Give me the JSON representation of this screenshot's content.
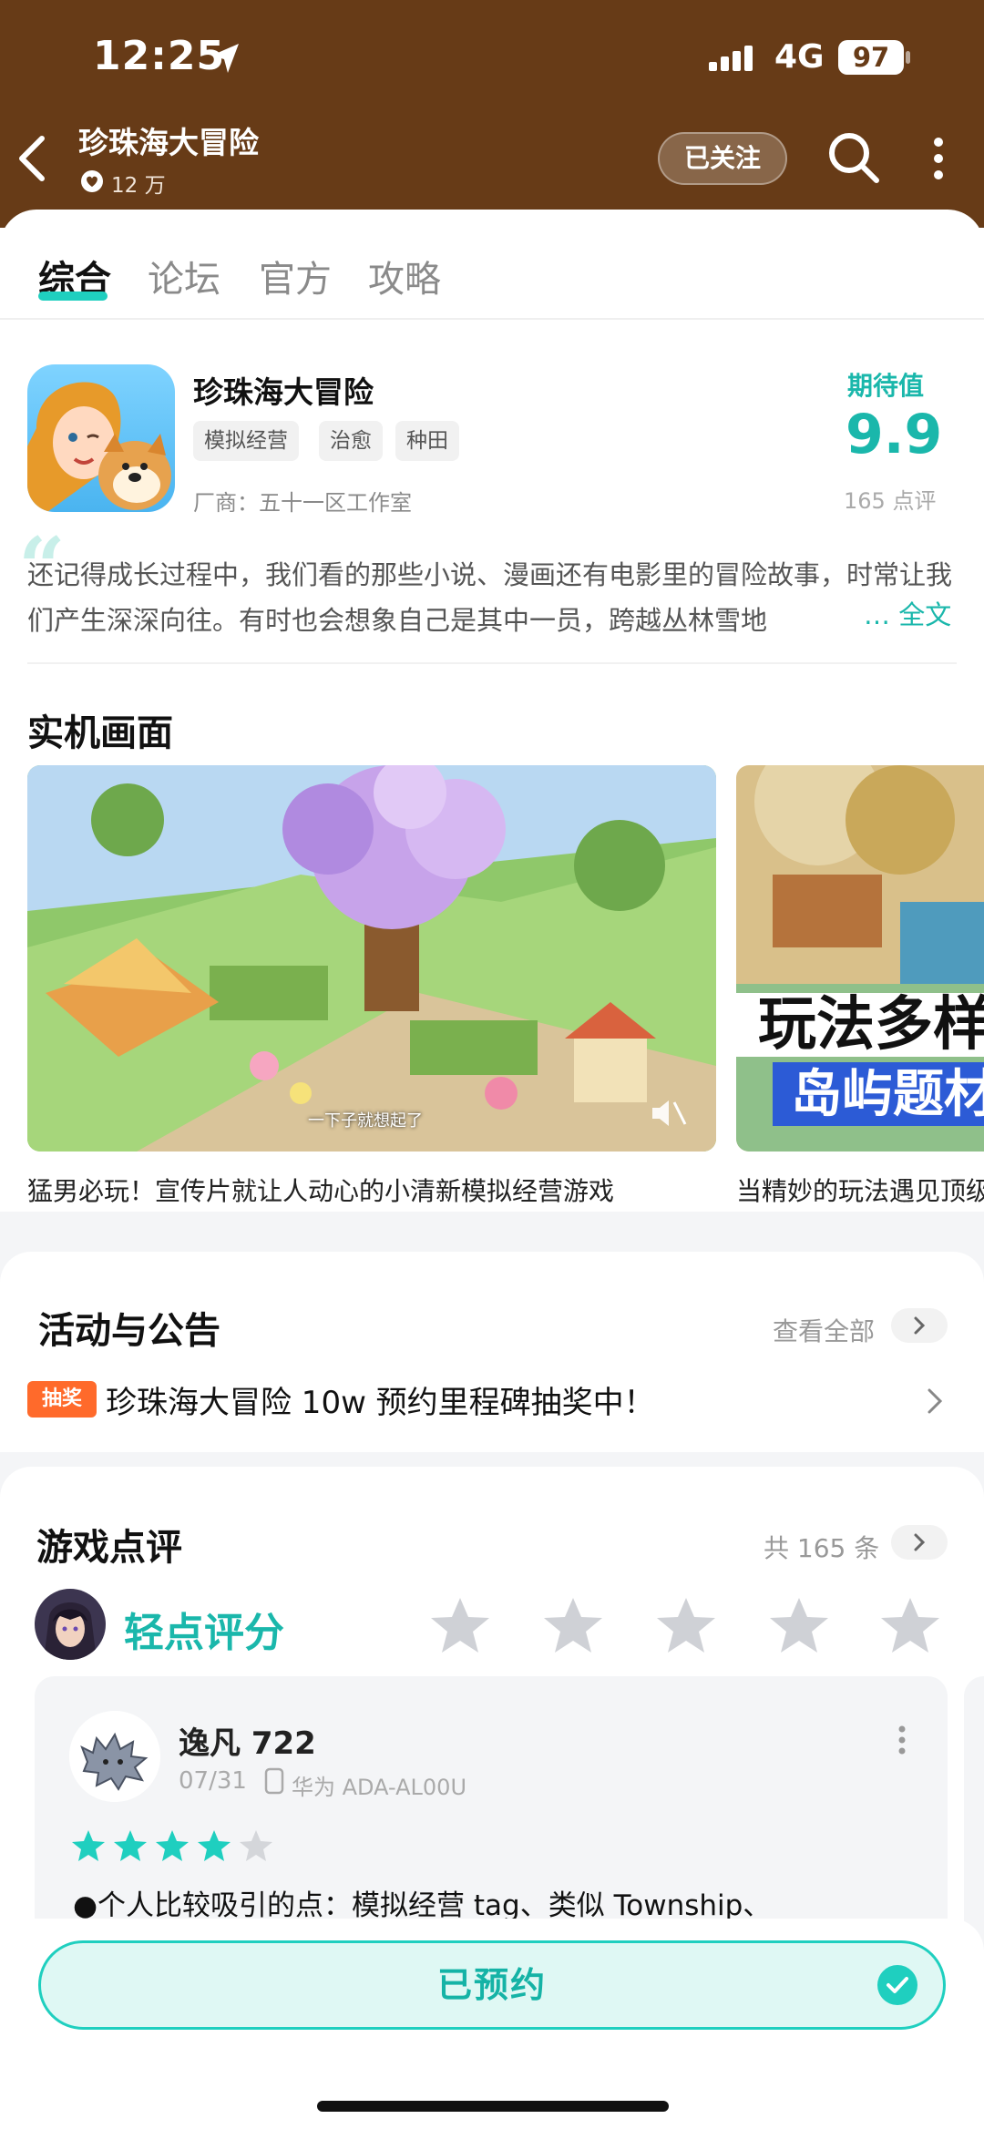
{
  "status_bar": {
    "time": "12:25",
    "network": "4G",
    "battery": "97"
  },
  "header": {
    "title": "珍珠海大冒险",
    "followers": "12 万",
    "follow_label": "已关注"
  },
  "tabs": [
    {
      "label": "综合",
      "active": true
    },
    {
      "label": "论坛",
      "active": false
    },
    {
      "label": "官方",
      "active": false
    },
    {
      "label": "攻略",
      "active": false
    }
  ],
  "game": {
    "name": "珍珠海大冒险",
    "tags": [
      "模拟经营",
      "治愈",
      "种田"
    ],
    "developer": "厂商：五十一区工作室",
    "rating_label": "期待值",
    "rating_value": "9.9",
    "rating_count": "165 点评",
    "description": "还记得成长过程中，我们看的那些小说、漫画还有电影里的冒险故事，时常让我们产生深深向往。有时也会想象自己是其中一员，跨越丛林雪地",
    "description_more": "… 全文"
  },
  "screenshots": {
    "title": "实机画面",
    "items": [
      {
        "caption": "猛男必玩！宣传片就让人动心的小清新模拟经营游戏",
        "subtitle": "一下子就想起了"
      },
      {
        "caption": "当精妙的玩法遇见顶级",
        "overlay_line1": "玩法多样",
        "overlay_line2": "岛屿题材"
      }
    ]
  },
  "events": {
    "title": "活动与公告",
    "view_all": "查看全部",
    "items": [
      {
        "badge": "抽奖",
        "text": "珍珠海大冒险 10w 预约里程碑抽奖中！"
      }
    ]
  },
  "reviews": {
    "title": "游戏点评",
    "count": "共 165 条",
    "tap_rate": "轻点评分",
    "items": [
      {
        "name": "逸凡 722",
        "date": "07/31",
        "device": "华为 ADA-AL00U",
        "stars": 4,
        "max_stars": 5,
        "text": "●个人比较吸引的点：模拟经营 tag、类似 Township、"
      }
    ]
  },
  "cta": {
    "label": "已预约"
  },
  "colors": {
    "brand": "#1fcfbf",
    "header": "#673b17",
    "badge": "#ff6a2b"
  },
  "icons": [
    "location-arrow-icon",
    "signal-icon",
    "back-icon",
    "heart-icon",
    "search-icon",
    "more-icon",
    "chevron-right-icon",
    "star-icon",
    "phone-icon",
    "check-circle-icon"
  ]
}
